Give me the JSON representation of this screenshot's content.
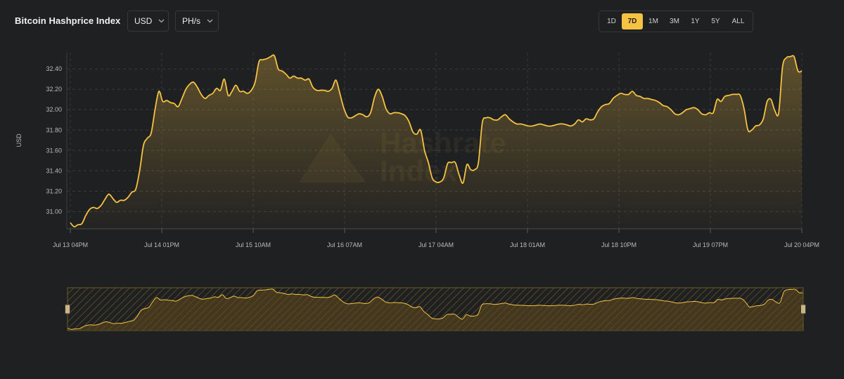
{
  "header": {
    "title": "Bitcoin Hashprice Index",
    "currency": {
      "value": "USD"
    },
    "unit": {
      "value": "PH/s"
    },
    "ranges": [
      {
        "label": "1D"
      },
      {
        "label": "7D",
        "active": true
      },
      {
        "label": "1M"
      },
      {
        "label": "3M"
      },
      {
        "label": "1Y"
      },
      {
        "label": "5Y"
      },
      {
        "label": "ALL"
      }
    ]
  },
  "watermark": {
    "line1": "Hashrate",
    "line2": "Index"
  },
  "colors": {
    "line": "#f5c242",
    "background": "#1f2022",
    "accent": "#f5c242"
  },
  "chart_data": {
    "type": "area",
    "ylabel": "USD",
    "yticks": [
      31.0,
      31.2,
      31.4,
      31.6,
      31.8,
      32.0,
      32.2,
      32.4
    ],
    "ylim": [
      30.83,
      32.56
    ],
    "xticks": [
      "Jul 13 04PM",
      "Jul 14 01PM",
      "Jul 15 10AM",
      "Jul 16 07AM",
      "Jul 17 04AM",
      "Jul 18 01AM",
      "Jul 18 10PM",
      "Jul 19 07PM",
      "Jul 20 04PM"
    ],
    "x_unit": "hours since Jul 13 04PM",
    "grid": true,
    "series": [
      {
        "points": [
          [
            0,
            30.89
          ],
          [
            1,
            30.85
          ],
          [
            2,
            30.87
          ],
          [
            3,
            30.88
          ],
          [
            4,
            30.96
          ],
          [
            5,
            31.02
          ],
          [
            6,
            31.04
          ],
          [
            7,
            31.03
          ],
          [
            8,
            31.06
          ],
          [
            9,
            31.12
          ],
          [
            10,
            31.17
          ],
          [
            11,
            31.13
          ],
          [
            12,
            31.09
          ],
          [
            13,
            31.11
          ],
          [
            14,
            31.11
          ],
          [
            15,
            31.14
          ],
          [
            16,
            31.19
          ],
          [
            17,
            31.22
          ],
          [
            18,
            31.4
          ],
          [
            19,
            31.65
          ],
          [
            20,
            31.72
          ],
          [
            21,
            31.77
          ],
          [
            22,
            32.0
          ],
          [
            23,
            32.18
          ],
          [
            24,
            32.08
          ],
          [
            25,
            32.09
          ],
          [
            26,
            32.07
          ],
          [
            27,
            32.06
          ],
          [
            28,
            32.03
          ],
          [
            29,
            32.11
          ],
          [
            30,
            32.2
          ],
          [
            31,
            32.25
          ],
          [
            32,
            32.27
          ],
          [
            33,
            32.22
          ],
          [
            34,
            32.15
          ],
          [
            35,
            32.11
          ],
          [
            36,
            32.14
          ],
          [
            37,
            32.16
          ],
          [
            38,
            32.21
          ],
          [
            39,
            32.19
          ],
          [
            40,
            32.3
          ],
          [
            41,
            32.14
          ],
          [
            42,
            32.18
          ],
          [
            43,
            32.24
          ],
          [
            44,
            32.18
          ],
          [
            45,
            32.18
          ],
          [
            46,
            32.16
          ],
          [
            47,
            32.19
          ],
          [
            48,
            32.27
          ],
          [
            49,
            32.47
          ],
          [
            50,
            32.49
          ],
          [
            51,
            32.5
          ],
          [
            52,
            32.52
          ],
          [
            53,
            32.53
          ],
          [
            54,
            32.4
          ],
          [
            55,
            32.38
          ],
          [
            56,
            32.35
          ],
          [
            57,
            32.31
          ],
          [
            58,
            32.33
          ],
          [
            59,
            32.31
          ],
          [
            60,
            32.31
          ],
          [
            61,
            32.29
          ],
          [
            62,
            32.3
          ],
          [
            63,
            32.22
          ],
          [
            64,
            32.19
          ],
          [
            65,
            32.19
          ],
          [
            66,
            32.19
          ],
          [
            67,
            32.18
          ],
          [
            68,
            32.21
          ],
          [
            69,
            32.29
          ],
          [
            70,
            32.16
          ],
          [
            71,
            32.02
          ],
          [
            72,
            31.93
          ],
          [
            73,
            31.92
          ],
          [
            74,
            31.94
          ],
          [
            75,
            31.96
          ],
          [
            76,
            31.95
          ],
          [
            77,
            31.93
          ],
          [
            78,
            31.97
          ],
          [
            79,
            32.12
          ],
          [
            80,
            32.2
          ],
          [
            81,
            32.13
          ],
          [
            82,
            32.01
          ],
          [
            83,
            31.96
          ],
          [
            84,
            31.97
          ],
          [
            85,
            31.97
          ],
          [
            86,
            31.96
          ],
          [
            87,
            31.94
          ],
          [
            88,
            31.88
          ],
          [
            89,
            31.78
          ],
          [
            90,
            31.76
          ],
          [
            91,
            31.8
          ],
          [
            92,
            31.6
          ],
          [
            93,
            31.48
          ],
          [
            94,
            31.33
          ],
          [
            95,
            31.29
          ],
          [
            96,
            31.29
          ],
          [
            97,
            31.33
          ],
          [
            98,
            31.47
          ],
          [
            99,
            31.48
          ],
          [
            100,
            31.48
          ],
          [
            101,
            31.36
          ],
          [
            102,
            31.28
          ],
          [
            103,
            31.46
          ],
          [
            104,
            31.41
          ],
          [
            105,
            31.41
          ],
          [
            106,
            31.48
          ],
          [
            107,
            31.87
          ],
          [
            108,
            31.92
          ],
          [
            109,
            31.92
          ],
          [
            110,
            31.9
          ],
          [
            111,
            31.9
          ],
          [
            112,
            31.93
          ],
          [
            113,
            31.95
          ],
          [
            114,
            31.91
          ],
          [
            115,
            31.88
          ],
          [
            116,
            31.86
          ],
          [
            117,
            31.86
          ],
          [
            118,
            31.85
          ],
          [
            119,
            31.84
          ],
          [
            120,
            31.84
          ],
          [
            121,
            31.85
          ],
          [
            122,
            31.86
          ],
          [
            123,
            31.85
          ],
          [
            124,
            31.84
          ],
          [
            125,
            31.84
          ],
          [
            126,
            31.85
          ],
          [
            127,
            31.86
          ],
          [
            128,
            31.86
          ],
          [
            129,
            31.85
          ],
          [
            130,
            31.84
          ],
          [
            131,
            31.86
          ],
          [
            132,
            31.9
          ],
          [
            133,
            31.88
          ],
          [
            134,
            31.91
          ],
          [
            135,
            31.9
          ],
          [
            136,
            31.91
          ],
          [
            137,
            31.98
          ],
          [
            138,
            32.03
          ],
          [
            139,
            32.05
          ],
          [
            140,
            32.06
          ],
          [
            141,
            32.11
          ],
          [
            142,
            32.14
          ],
          [
            143,
            32.16
          ],
          [
            144,
            32.15
          ],
          [
            145,
            32.15
          ],
          [
            146,
            32.18
          ],
          [
            147,
            32.14
          ],
          [
            148,
            32.13
          ],
          [
            149,
            32.11
          ],
          [
            150,
            32.11
          ],
          [
            151,
            32.1
          ],
          [
            152,
            32.09
          ],
          [
            153,
            32.07
          ],
          [
            154,
            32.04
          ],
          [
            155,
            32.03
          ],
          [
            156,
            32.0
          ],
          [
            157,
            31.96
          ],
          [
            158,
            31.95
          ],
          [
            159,
            31.97
          ],
          [
            160,
            32.0
          ],
          [
            161,
            32.01
          ],
          [
            162,
            32.02
          ],
          [
            163,
            32.0
          ],
          [
            164,
            31.96
          ],
          [
            165,
            31.95
          ],
          [
            166,
            31.97
          ],
          [
            167,
            31.97
          ],
          [
            168,
            32.1
          ],
          [
            169,
            32.08
          ],
          [
            170,
            32.13
          ],
          [
            171,
            32.14
          ],
          [
            172,
            32.15
          ],
          [
            173,
            32.15
          ],
          [
            174,
            32.14
          ],
          [
            175,
            32.01
          ],
          [
            176,
            31.8
          ],
          [
            177,
            31.8
          ],
          [
            178,
            31.84
          ],
          [
            179,
            31.85
          ],
          [
            180,
            31.91
          ],
          [
            181,
            32.08
          ],
          [
            182,
            32.1
          ],
          [
            183,
            31.99
          ],
          [
            184,
            31.97
          ],
          [
            185,
            32.42
          ],
          [
            186,
            32.51
          ],
          [
            187,
            32.52
          ],
          [
            188,
            32.52
          ],
          [
            189,
            32.38
          ],
          [
            190,
            32.38
          ]
        ]
      }
    ]
  }
}
